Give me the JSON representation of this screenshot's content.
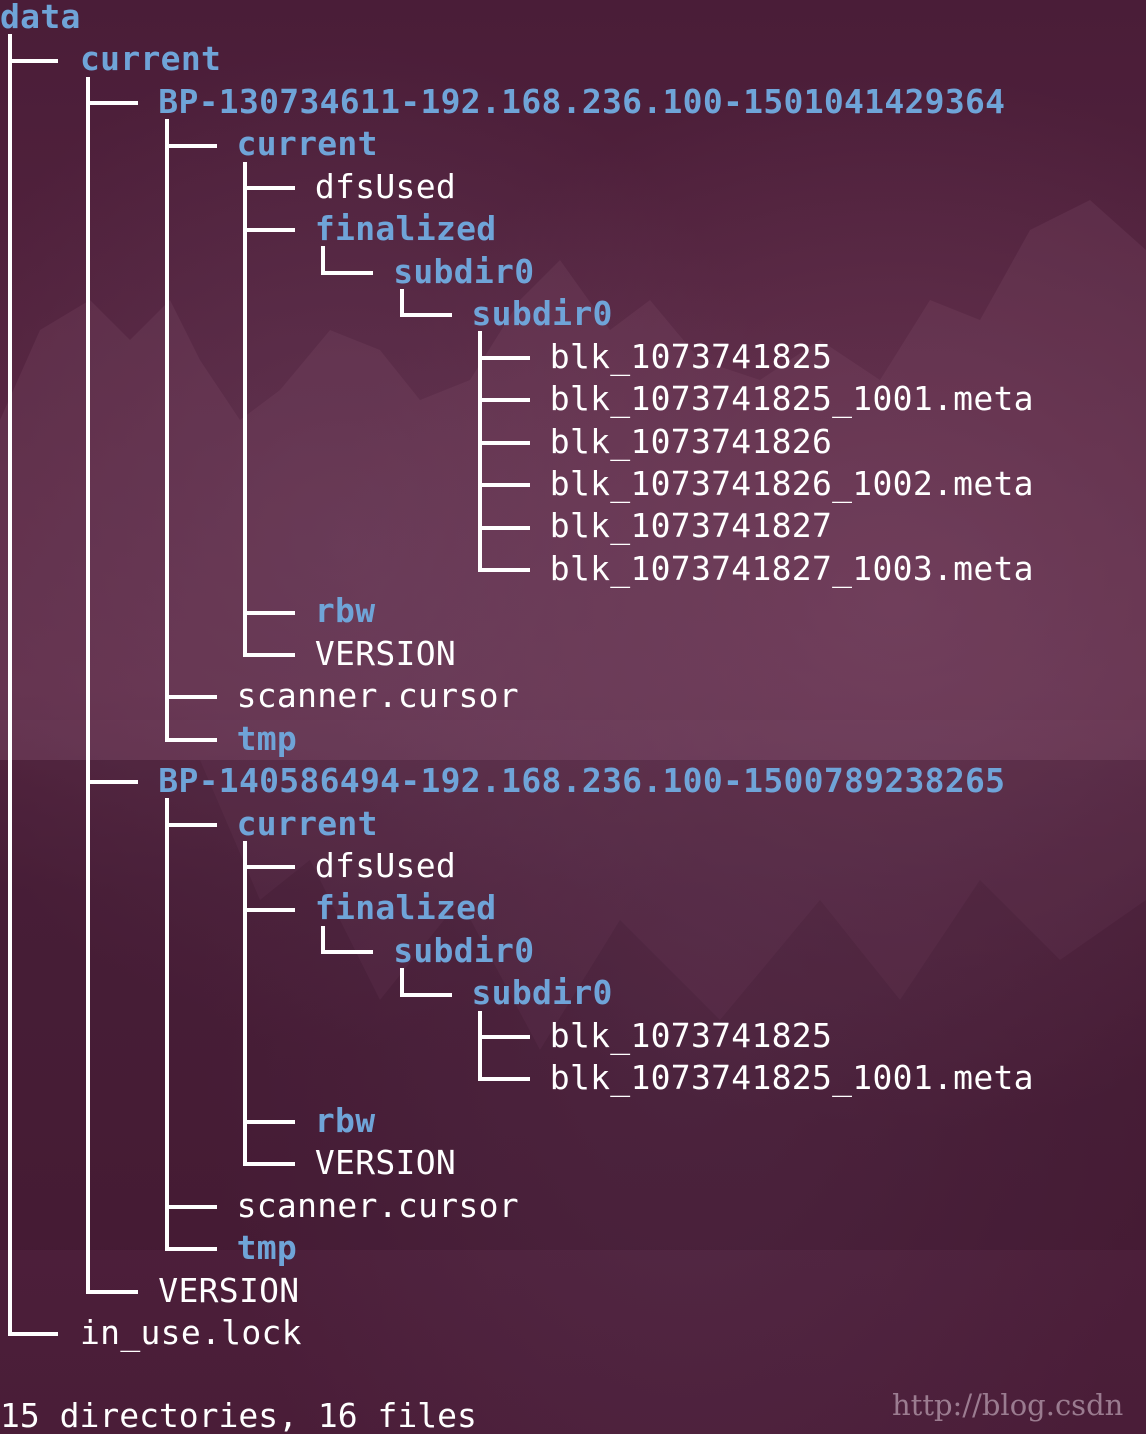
{
  "root": "data",
  "tree": [
    {
      "depth": 1,
      "name": "current",
      "type": "dir",
      "last": false
    },
    {
      "depth": 2,
      "name": "BP-130734611-192.168.236.100-1501041429364",
      "type": "dir",
      "last": false
    },
    {
      "depth": 3,
      "name": "current",
      "type": "dir",
      "last": false
    },
    {
      "depth": 4,
      "name": "dfsUsed",
      "type": "file",
      "last": false
    },
    {
      "depth": 4,
      "name": "finalized",
      "type": "dir",
      "last": false
    },
    {
      "depth": 5,
      "name": "subdir0",
      "type": "dir",
      "last": true
    },
    {
      "depth": 6,
      "name": "subdir0",
      "type": "dir",
      "last": true
    },
    {
      "depth": 7,
      "name": "blk_1073741825",
      "type": "file",
      "last": false
    },
    {
      "depth": 7,
      "name": "blk_1073741825_1001.meta",
      "type": "file",
      "last": false
    },
    {
      "depth": 7,
      "name": "blk_1073741826",
      "type": "file",
      "last": false
    },
    {
      "depth": 7,
      "name": "blk_1073741826_1002.meta",
      "type": "file",
      "last": false
    },
    {
      "depth": 7,
      "name": "blk_1073741827",
      "type": "file",
      "last": false
    },
    {
      "depth": 7,
      "name": "blk_1073741827_1003.meta",
      "type": "file",
      "last": true
    },
    {
      "depth": 4,
      "name": "rbw",
      "type": "dir",
      "last": false
    },
    {
      "depth": 4,
      "name": "VERSION",
      "type": "file",
      "last": true
    },
    {
      "depth": 3,
      "name": "scanner.cursor",
      "type": "file",
      "last": false
    },
    {
      "depth": 3,
      "name": "tmp",
      "type": "dir",
      "last": true
    },
    {
      "depth": 2,
      "name": "BP-140586494-192.168.236.100-1500789238265",
      "type": "dir",
      "last": false
    },
    {
      "depth": 3,
      "name": "current",
      "type": "dir",
      "last": false
    },
    {
      "depth": 4,
      "name": "dfsUsed",
      "type": "file",
      "last": false
    },
    {
      "depth": 4,
      "name": "finalized",
      "type": "dir",
      "last": false
    },
    {
      "depth": 5,
      "name": "subdir0",
      "type": "dir",
      "last": true
    },
    {
      "depth": 6,
      "name": "subdir0",
      "type": "dir",
      "last": true
    },
    {
      "depth": 7,
      "name": "blk_1073741825",
      "type": "file",
      "last": false
    },
    {
      "depth": 7,
      "name": "blk_1073741825_1001.meta",
      "type": "file",
      "last": true
    },
    {
      "depth": 4,
      "name": "rbw",
      "type": "dir",
      "last": false
    },
    {
      "depth": 4,
      "name": "VERSION",
      "type": "file",
      "last": true
    },
    {
      "depth": 3,
      "name": "scanner.cursor",
      "type": "file",
      "last": false
    },
    {
      "depth": 3,
      "name": "tmp",
      "type": "dir",
      "last": true
    },
    {
      "depth": 2,
      "name": "VERSION",
      "type": "file",
      "last": true
    },
    {
      "depth": 1,
      "name": "in_use.lock",
      "type": "file",
      "last": true
    }
  ],
  "summary": "15 directories, 16 files",
  "watermark": "http://blog.csdn",
  "colors": {
    "directory": "#6fa4d8",
    "file": "#ffffff",
    "background": "#4b1f3a"
  }
}
